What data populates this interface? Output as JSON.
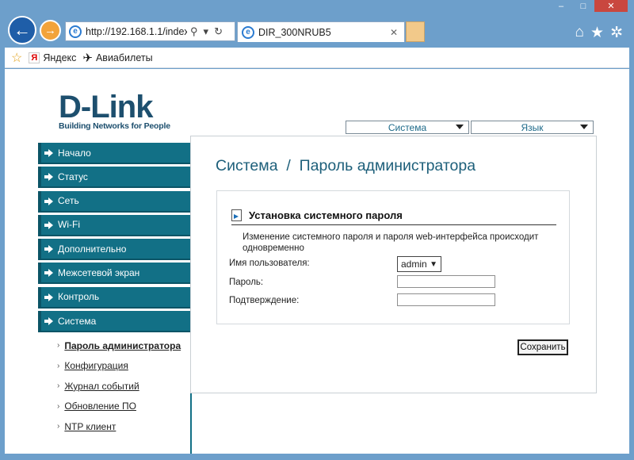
{
  "browser": {
    "address": "http://192.168.1.1/index",
    "tab_title": "DIR_300NRUB5",
    "favorites": [
      {
        "label": "Яндекс"
      },
      {
        "label": "Авиабилеты"
      }
    ]
  },
  "brand": {
    "logo_main": "D-Link",
    "logo_sub": "Building Networks for People"
  },
  "top_menu": {
    "system": "Система",
    "language": "Язык"
  },
  "sidebar": {
    "items": [
      {
        "label": "Начало"
      },
      {
        "label": "Статус"
      },
      {
        "label": "Сеть"
      },
      {
        "label": "Wi-Fi"
      },
      {
        "label": "Дополнительно"
      },
      {
        "label": "Межсетевой экран"
      },
      {
        "label": "Контроль"
      },
      {
        "label": "Система"
      }
    ],
    "submenu": [
      {
        "label": "Пароль администратора"
      },
      {
        "label": "Конфигурация"
      },
      {
        "label": "Журнал событий"
      },
      {
        "label": "Обновление ПО"
      },
      {
        "label": "NTP клиент"
      }
    ]
  },
  "main": {
    "title": "Система  /  Пароль администратора",
    "section_title": "Установка системного пароля",
    "description": "Изменение системного пароля и пароля web-интерфейса происходит одновременно",
    "username_label": "Имя пользователя:",
    "username_value": "admin",
    "password_label": "Пароль:",
    "confirm_label": "Подтверждение:",
    "save_label": "Сохранить"
  }
}
